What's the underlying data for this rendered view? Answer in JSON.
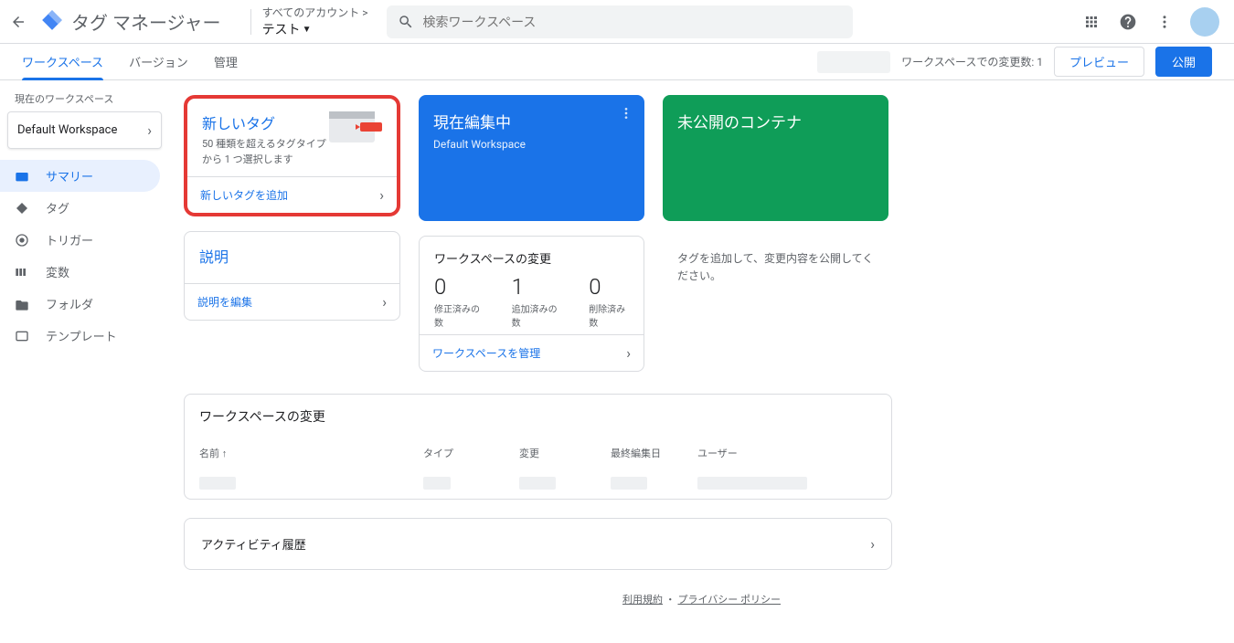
{
  "header": {
    "app_title": "タグ マネージャー",
    "all_accounts": "すべてのアカウント >",
    "container_name": "テスト",
    "search_placeholder": "検索ワークスペース"
  },
  "tabs": {
    "workspace": "ワークスペース",
    "versions": "バージョン",
    "admin": "管理"
  },
  "nav_right": {
    "changes_label": "ワークスペースでの変更数: 1",
    "preview": "プレビュー",
    "publish": "公開"
  },
  "sidebar": {
    "current_ws_label": "現在のワークスペース",
    "ws_name": "Default Workspace",
    "items": [
      {
        "label": "サマリー"
      },
      {
        "label": "タグ"
      },
      {
        "label": "トリガー"
      },
      {
        "label": "変数"
      },
      {
        "label": "フォルダ"
      },
      {
        "label": "テンプレート"
      }
    ]
  },
  "new_tag_card": {
    "title": "新しいタグ",
    "desc": "50 種類を超えるタグタイプから 1 つ選択します",
    "action": "新しいタグを追加"
  },
  "desc_card": {
    "title": "説明",
    "action": "説明を編集"
  },
  "editing_card": {
    "title": "現在編集中",
    "sub": "Default Workspace"
  },
  "stats_card": {
    "title": "ワークスペースの変更",
    "s0_num": "0",
    "s0_label": "修正済みの数",
    "s1_num": "1",
    "s1_label": "追加済みの数",
    "s2_num": "0",
    "s2_label": "削除済み数",
    "action": "ワークスペースを管理"
  },
  "unpub_card": {
    "title": "未公開のコンテナ",
    "msg": "タグを追加して、変更内容を公開してください。"
  },
  "changes_panel": {
    "title": "ワークスペースの変更",
    "col_name": "名前 ↑",
    "col_type": "タイプ",
    "col_change": "変更",
    "col_edit": "最終編集日",
    "col_user": "ユーザー"
  },
  "activity_panel": {
    "title": "アクティビティ履歴"
  },
  "footer": {
    "terms": "利用規約",
    "sep": " ・ ",
    "privacy": "プライバシー ポリシー"
  }
}
